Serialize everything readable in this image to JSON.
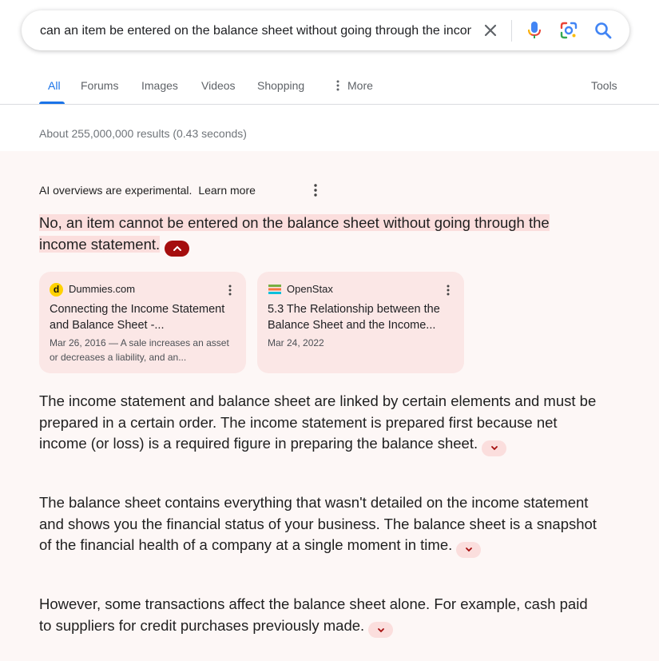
{
  "search": {
    "query": "can an item be entered on the balance sheet without going through the income statement"
  },
  "tabs": [
    {
      "label": "All",
      "active": true
    },
    {
      "label": "Forums"
    },
    {
      "label": "Images"
    },
    {
      "label": "Videos"
    },
    {
      "label": "Shopping"
    },
    {
      "label": "More"
    }
  ],
  "tools_label": "Tools",
  "result_stats": "About 255,000,000 results (0.43 seconds)",
  "ai_overview": {
    "notice": "AI overviews are experimental.",
    "learn_more": "Learn more",
    "headline": "No, an item cannot be entered on the balance sheet without going through the income statement.",
    "sources": [
      {
        "site": "Dummies.com",
        "title": "Connecting the Income Statement and Balance Sheet -...",
        "date_snippet": "Mar 26, 2016 — A sale increases an asset or decreases a liability, and an..."
      },
      {
        "site": "OpenStax",
        "title": "5.3 The Relationship between the Balance Sheet and the Income...",
        "date_snippet": "Mar 24, 2022"
      }
    ],
    "paragraphs": [
      "The income statement and balance sheet are linked by certain elements and must be prepared in a certain order. The income statement is prepared first because net income (or loss) is a required figure in preparing the balance sheet.",
      "The balance sheet contains everything that wasn't detailed on the income statement and shows you the financial status of your business. The balance sheet is a snapshot of the financial health of a company at a single moment in time.",
      "However, some transactions affect the balance sheet alone. For example, cash paid to suppliers for credit purchases previously made."
    ]
  },
  "colors": {
    "accent": "#1a73e8",
    "panel_bg": "#fdf7f6",
    "highlight": "#fbdedd",
    "collapse_btn": "#a50e0e",
    "card_bg": "#fbe7e6"
  }
}
